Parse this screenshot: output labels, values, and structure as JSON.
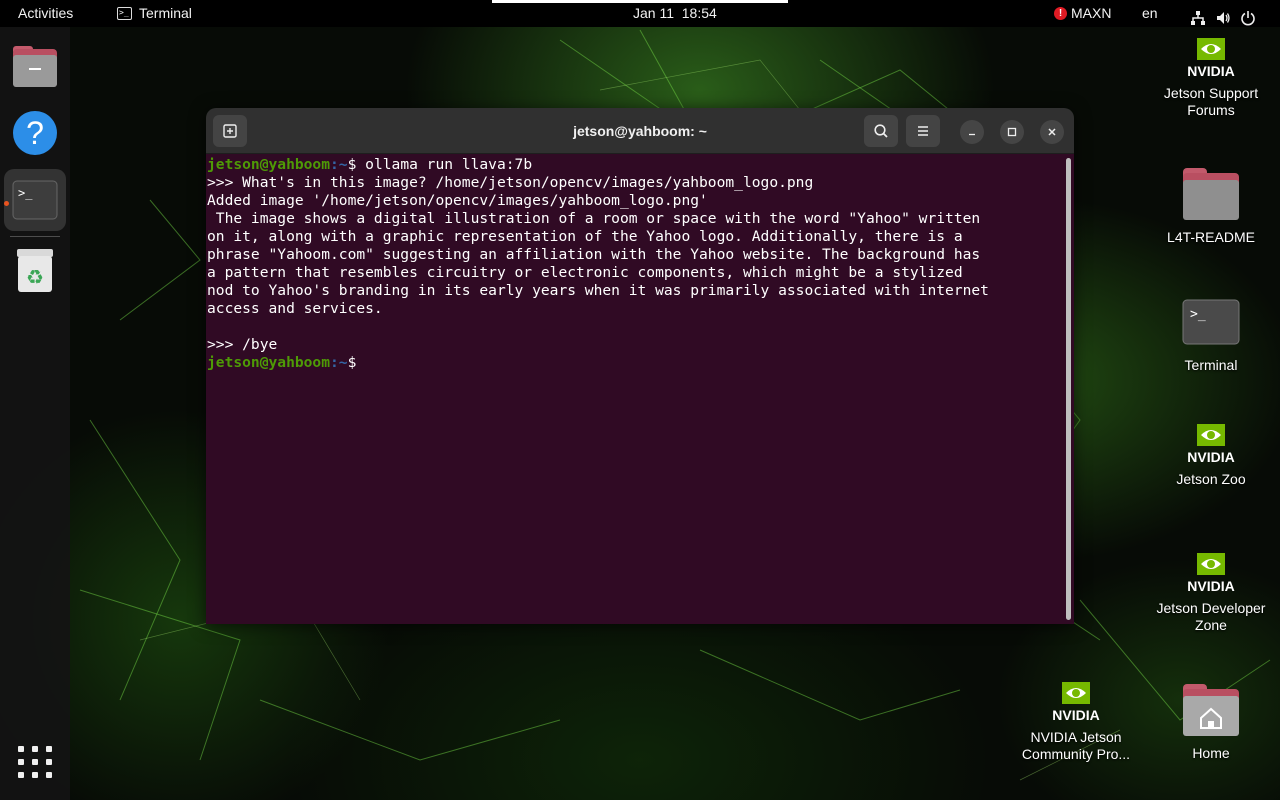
{
  "topbar": {
    "activities": "Activities",
    "app_name": "Terminal",
    "clock": "Jan 11  18:54",
    "power_mode": "MAXN",
    "warning_symbol": "!",
    "input_language": "en",
    "icons": [
      "network-icon",
      "volume-icon",
      "power-icon"
    ]
  },
  "dock": {
    "items": [
      {
        "name": "files-icon"
      },
      {
        "name": "help-icon",
        "symbol": "?"
      },
      {
        "name": "terminal-icon",
        "symbol": ">_",
        "running": true
      },
      {
        "name": "trash-icon",
        "symbol": "♻"
      }
    ],
    "show_apps": "show-apps-icon"
  },
  "terminal": {
    "title": "jetson@yahboom: ~",
    "prompt_user": "jetson@yahboom",
    "prompt_path": ":~",
    "prompt_symbol": "$ ",
    "command": "ollama run llava:7b",
    "output_lines": [
      ">>> What's in this image? /home/jetson/opencv/images/yahboom_logo.png",
      "Added image '/home/jetson/opencv/images/yahboom_logo.png'",
      " The image shows a digital illustration of a room or space with the word \"Yahoo\" written",
      "on it, along with a graphic representation of the Yahoo logo. Additionally, there is a",
      "phrase \"Yahoom.com\" suggesting an affiliation with the Yahoo website. The background has",
      "a pattern that resembles circuitry or electronic components, which might be a stylized",
      "nod to Yahoo's branding in its early years when it was primarily associated with internet",
      "access and services.",
      "",
      ">>> /bye"
    ],
    "final_prompt_symbol": "$"
  },
  "desktop": {
    "icons": [
      {
        "label": "Jetson Support Forums",
        "line1": "Jetson Support",
        "line2": "Forums",
        "kind": "nvidia"
      },
      {
        "label": "L4T-README",
        "kind": "folder"
      },
      {
        "label": "Terminal",
        "kind": "terminal",
        "symbol": ">_"
      },
      {
        "label": "Jetson Zoo",
        "kind": "nvidia"
      },
      {
        "label": "Jetson Developer Zone",
        "line1": "Jetson Developer",
        "line2": "Zone",
        "kind": "nvidia"
      },
      {
        "label": "NVIDIA Jetson Community Pro...",
        "line1": "NVIDIA Jetson",
        "line2": "Community Pro...",
        "kind": "nvidia"
      },
      {
        "label": "Home",
        "kind": "home-folder"
      }
    ],
    "nvidia_wordmark": "NVIDIA"
  },
  "colors": {
    "terminal_bg": "#300a24",
    "prompt_user": "#4e9a06",
    "prompt_path": "#3465a4",
    "accent": "#76b900"
  }
}
